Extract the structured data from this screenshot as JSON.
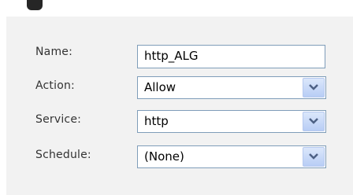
{
  "form": {
    "name": {
      "label": "Name:",
      "value": "http_ALG"
    },
    "action": {
      "label": "Action:",
      "value": "Allow"
    },
    "service": {
      "label": "Service:",
      "value": "http"
    },
    "schedule": {
      "label": "Schedule:",
      "value": "(None)"
    }
  },
  "colors": {
    "panel_background": "#f2f2f2",
    "field_border": "#7f9db9",
    "dropdown_button": "#c8d8f8",
    "dropdown_arrow": "#4d6185"
  },
  "icons": {
    "dropdown": "chevron-down-icon"
  }
}
